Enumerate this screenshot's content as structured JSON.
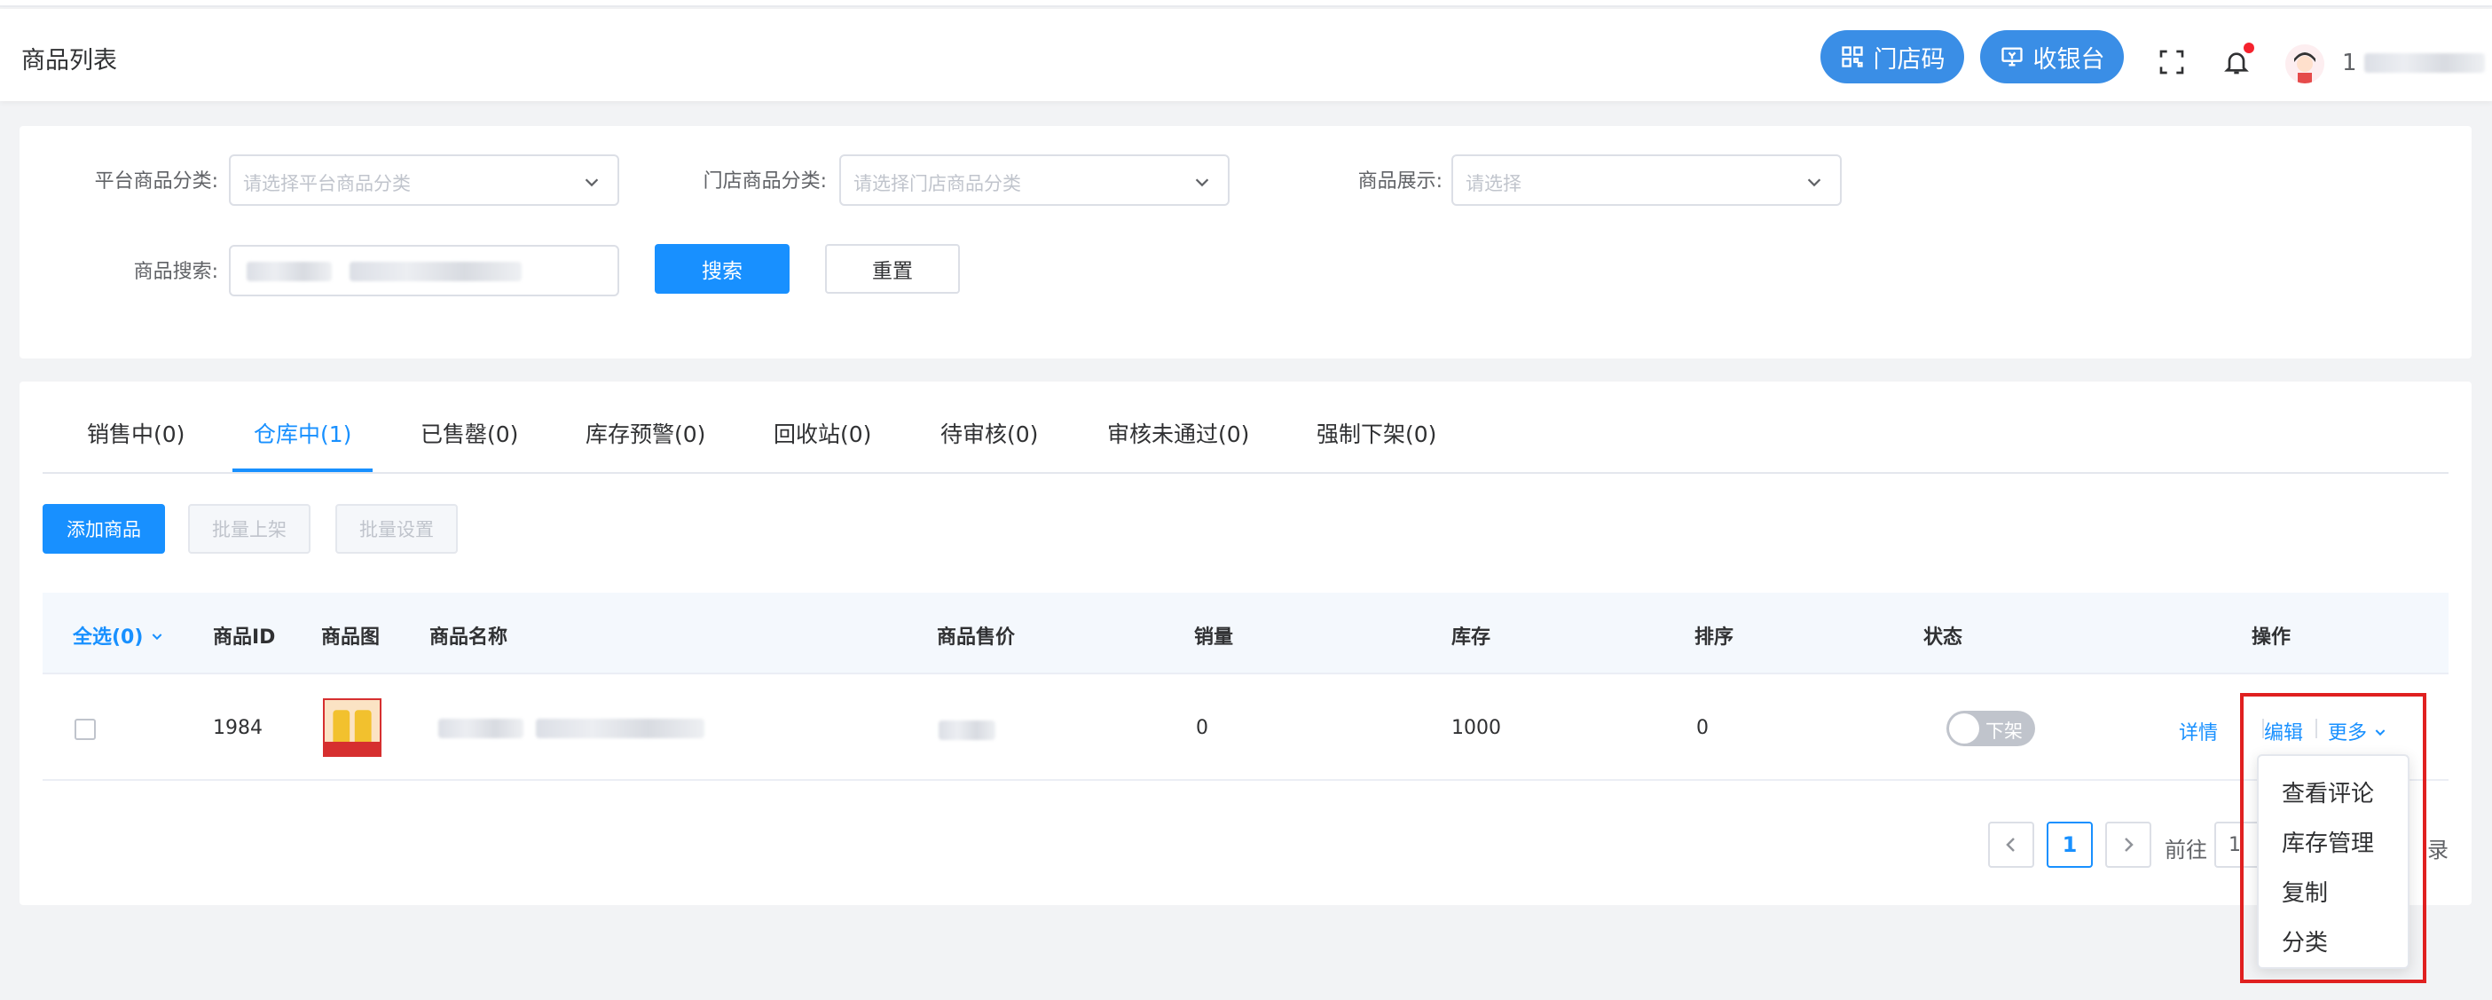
{
  "header": {
    "title": "商品列表",
    "store_code_label": "门店码",
    "cashier_label": "收银台",
    "user_initial": "1"
  },
  "filters": {
    "platform_category": {
      "label": "平台商品分类:",
      "placeholder": "请选择平台商品分类"
    },
    "store_category": {
      "label": "门店商品分类:",
      "placeholder": "请选择门店商品分类"
    },
    "display": {
      "label": "商品展示:",
      "placeholder": "请选择"
    },
    "search": {
      "label": "商品搜索:"
    },
    "search_button": "搜索",
    "reset_button": "重置"
  },
  "tabs": [
    {
      "label": "销售中(0)"
    },
    {
      "label": "仓库中(1)"
    },
    {
      "label": "已售罄(0)"
    },
    {
      "label": "库存预警(0)"
    },
    {
      "label": "回收站(0)"
    },
    {
      "label": "待审核(0)"
    },
    {
      "label": "审核未通过(0)"
    },
    {
      "label": "强制下架(0)"
    }
  ],
  "active_tab": 1,
  "actions": {
    "add": "添加商品",
    "batch_on_shelf": "批量上架",
    "batch_settings": "批量设置"
  },
  "table": {
    "columns": {
      "select_all": "全选(0)",
      "id": "商品ID",
      "image": "商品图",
      "name": "商品名称",
      "price": "商品售价",
      "sales": "销量",
      "stock": "库存",
      "sort": "排序",
      "status": "状态",
      "operations": "操作"
    },
    "rows": [
      {
        "id": "1984",
        "sales": "0",
        "stock": "1000",
        "sort": "0",
        "status": "下架",
        "status_on": false,
        "ops": {
          "detail": "详情",
          "edit": "编辑",
          "more": "更多"
        }
      }
    ]
  },
  "pagination": {
    "current_page": "1",
    "goto_label": "前往",
    "goto_value": "1",
    "tail_text": "录"
  },
  "more_menu": {
    "items": [
      {
        "label": "查看评论"
      },
      {
        "label": "库存管理"
      },
      {
        "label": "复制"
      },
      {
        "label": "分类"
      }
    ]
  },
  "colors": {
    "primary": "#1890ff",
    "pill": "#3a8ee6",
    "highlight": "#e02020",
    "badge": "#f5222d"
  }
}
